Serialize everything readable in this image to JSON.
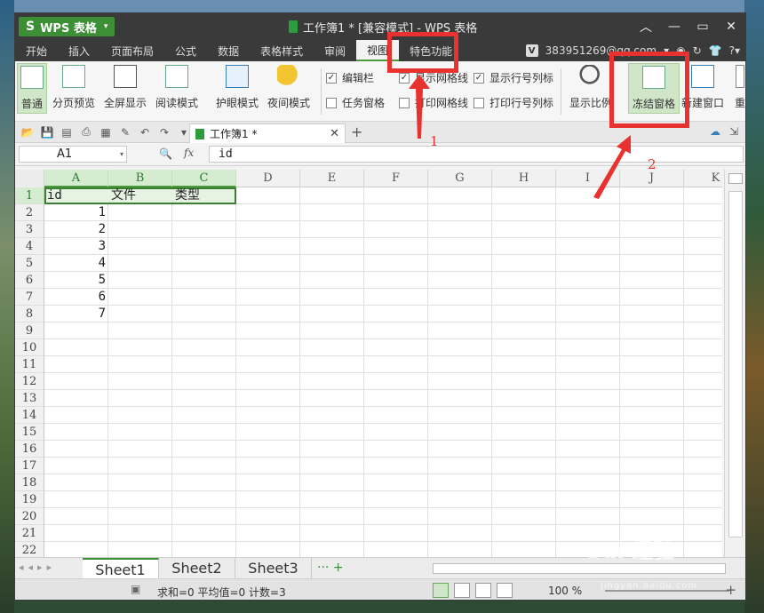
{
  "app": {
    "name": "WPS 表格",
    "logo": "S",
    "window_title": "工作簿1 * [兼容模式] - WPS 表格"
  },
  "menu": {
    "tabs": [
      "开始",
      "插入",
      "页面布局",
      "公式",
      "数据",
      "表格样式",
      "审阅",
      "视图",
      "特色功能"
    ],
    "active": "视图",
    "account": "383951269@qq.com"
  },
  "ribbon": {
    "buttons": [
      "普通",
      "分页预览",
      "全屏显示",
      "阅读模式",
      "护眼模式",
      "夜间模式",
      "显示比例",
      "冻结窗格",
      "新建窗口",
      "重"
    ],
    "selected": "普通",
    "checks": [
      {
        "label": "编辑栏",
        "checked": true
      },
      {
        "label": "任务窗格",
        "checked": false
      },
      {
        "label": "显示网格线",
        "checked": true
      },
      {
        "label": "打印网格线",
        "checked": false
      },
      {
        "label": "显示行号列标",
        "checked": true
      },
      {
        "label": "打印行号列标",
        "checked": false
      }
    ]
  },
  "quick_access": {
    "doc_tab": "工作簿1 *"
  },
  "formula_bar": {
    "name_box": "A1",
    "fx": "fx",
    "content": "id"
  },
  "grid": {
    "columns": [
      "A",
      "B",
      "C",
      "D",
      "E",
      "F",
      "G",
      "H",
      "I",
      "J",
      "K"
    ],
    "selected_columns": [
      "A",
      "B",
      "C"
    ],
    "rows": [
      "1",
      "2",
      "3",
      "4",
      "5",
      "6",
      "7",
      "8",
      "9",
      "10",
      "11",
      "12",
      "13",
      "14",
      "15",
      "16",
      "17",
      "18",
      "19",
      "20",
      "21",
      "22"
    ],
    "header_row": [
      "id",
      "文件",
      "类型"
    ],
    "id_values": [
      "1",
      "2",
      "3",
      "4",
      "5",
      "6",
      "7"
    ]
  },
  "sheets": {
    "tabs": [
      "Sheet1",
      "Sheet2",
      "Sheet3"
    ],
    "active": "Sheet1"
  },
  "status": {
    "summary": "求和=0  平均值=0  计数=3",
    "zoom": "100 %"
  },
  "annotations": {
    "labels": [
      "1",
      "2"
    ]
  },
  "watermark": {
    "text": "Bai 经验",
    "sub": "jingyan.baidu.com"
  },
  "colors": {
    "accent": "#3c8f34",
    "annotation": "#e8322f",
    "titlebar": "#3a3a3a"
  }
}
